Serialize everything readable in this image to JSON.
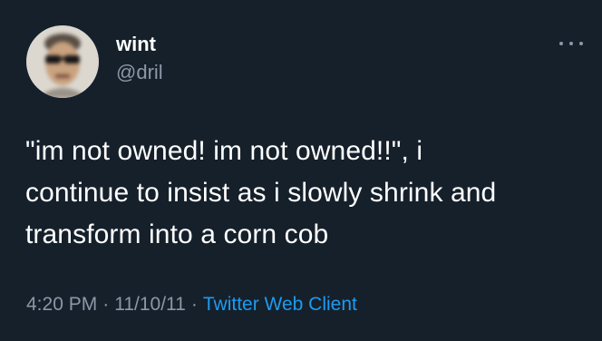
{
  "author": {
    "name": "wint",
    "handle": "@dril"
  },
  "tweet": {
    "lines": [
      "\"im not owned!  im not owned!!\", i",
      "continue to insist as i slowly shrink and",
      "transform into a corn cob"
    ]
  },
  "meta": {
    "time": "4:20 PM",
    "separator": "·",
    "date": "11/10/11",
    "client": "Twitter Web Client"
  },
  "icons": {
    "more": "more-horizontal-icon"
  },
  "colors": {
    "background": "#15202b",
    "text": "#ffffff",
    "secondary": "#8b98a5",
    "link": "#1d9bf0"
  }
}
